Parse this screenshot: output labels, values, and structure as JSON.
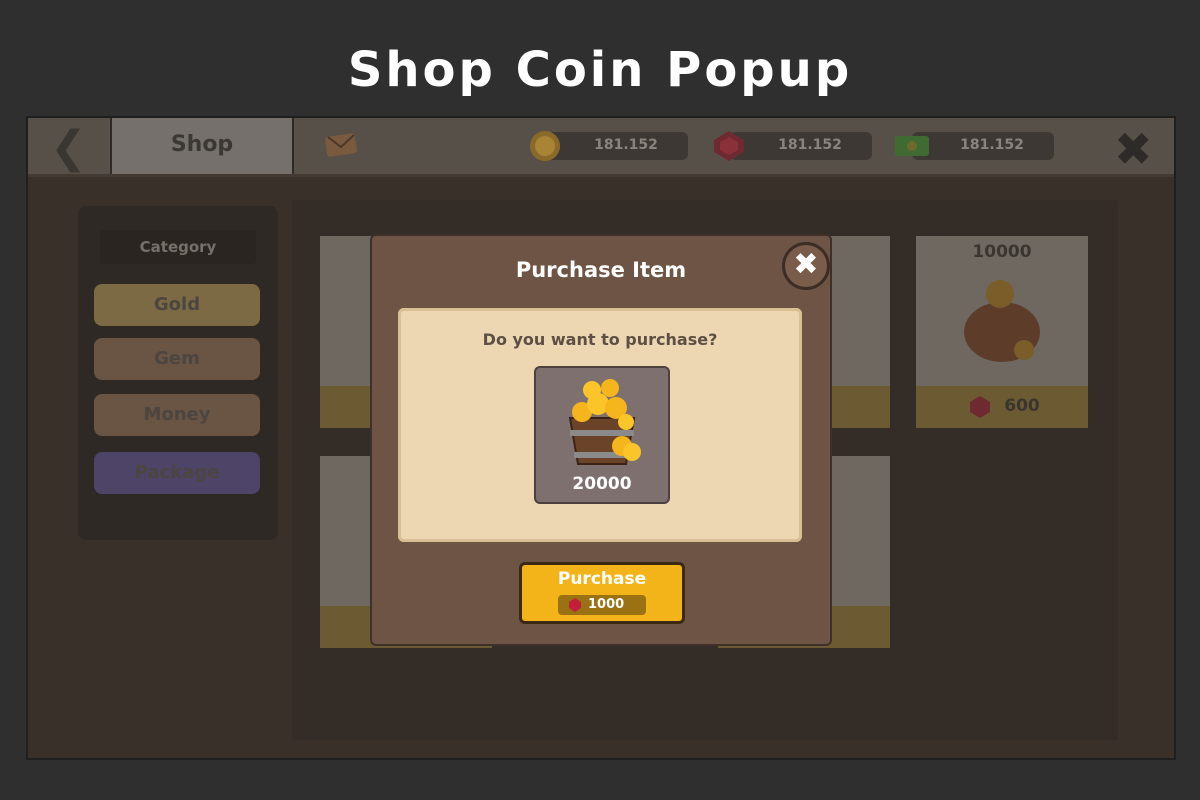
{
  "page": {
    "title": "Shop Coin Popup"
  },
  "header": {
    "back_icon": "chevron-left-icon",
    "tab_label": "Shop",
    "resources": [
      {
        "icon": "coin-icon",
        "value": "181.152"
      },
      {
        "icon": "gem-icon",
        "value": "181.152"
      },
      {
        "icon": "cash-icon",
        "value": "181.152"
      }
    ],
    "close_icon": "close-icon"
  },
  "sidebar": {
    "category_label": "Category",
    "items": [
      {
        "label": "Gold"
      },
      {
        "label": "Gem"
      },
      {
        "label": "Money"
      },
      {
        "label": "Package"
      }
    ]
  },
  "cards": [
    {
      "amount": "10000",
      "price": "600"
    }
  ],
  "popup": {
    "title": "Purchase Item",
    "question": "Do you want to purchase?",
    "item_quantity": "20000",
    "purchase_label": "Purchase",
    "purchase_cost": "1000"
  },
  "colors": {
    "accent": "#f2b418",
    "gem": "#c2203a",
    "popup": "#6e5444",
    "paper": "#ecd7b2"
  }
}
